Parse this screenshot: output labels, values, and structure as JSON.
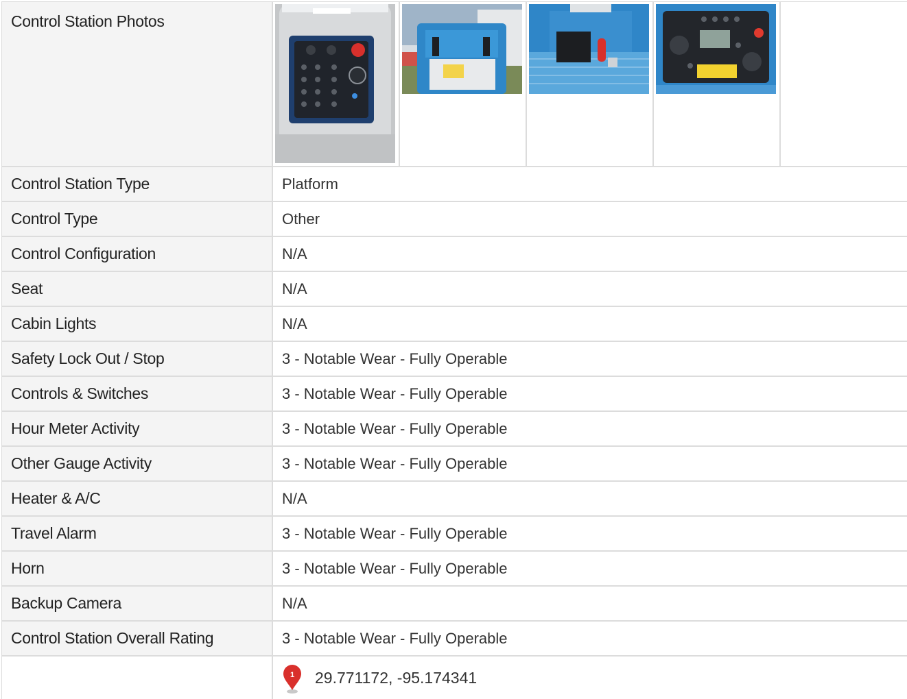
{
  "photos_row": {
    "label": "Control Station Photos",
    "photos": [
      {
        "icon": "control-panel-photo"
      },
      {
        "icon": "platform-controls-photo"
      },
      {
        "icon": "platform-deck-photo"
      },
      {
        "icon": "control-box-photo"
      }
    ]
  },
  "rows": [
    {
      "label": "Control Station Type",
      "value": "Platform"
    },
    {
      "label": "Control Type",
      "value": "Other"
    },
    {
      "label": "Control Configuration",
      "value": "N/A"
    },
    {
      "label": "Seat",
      "value": "N/A"
    },
    {
      "label": "Cabin Lights",
      "value": "N/A"
    },
    {
      "label": "Safety Lock Out / Stop",
      "value": "3 - Notable Wear - Fully Operable"
    },
    {
      "label": "Controls & Switches",
      "value": "3 - Notable Wear - Fully Operable"
    },
    {
      "label": "Hour Meter Activity",
      "value": "3 - Notable Wear - Fully Operable"
    },
    {
      "label": "Other Gauge Activity",
      "value": "3 - Notable Wear - Fully Operable"
    },
    {
      "label": "Heater & A/C",
      "value": "N/A"
    },
    {
      "label": "Travel Alarm",
      "value": "3 - Notable Wear - Fully Operable"
    },
    {
      "label": "Horn",
      "value": "3 - Notable Wear - Fully Operable"
    },
    {
      "label": "Backup Camera",
      "value": "N/A"
    },
    {
      "label": "Control Station Overall Rating",
      "value": "3 - Notable Wear - Fully Operable"
    }
  ],
  "location": {
    "label": "",
    "marker_number": "1",
    "coordinates": "29.771172, -95.174341",
    "marker_icon": "map-marker-icon",
    "marker_color": "#d9302c"
  }
}
